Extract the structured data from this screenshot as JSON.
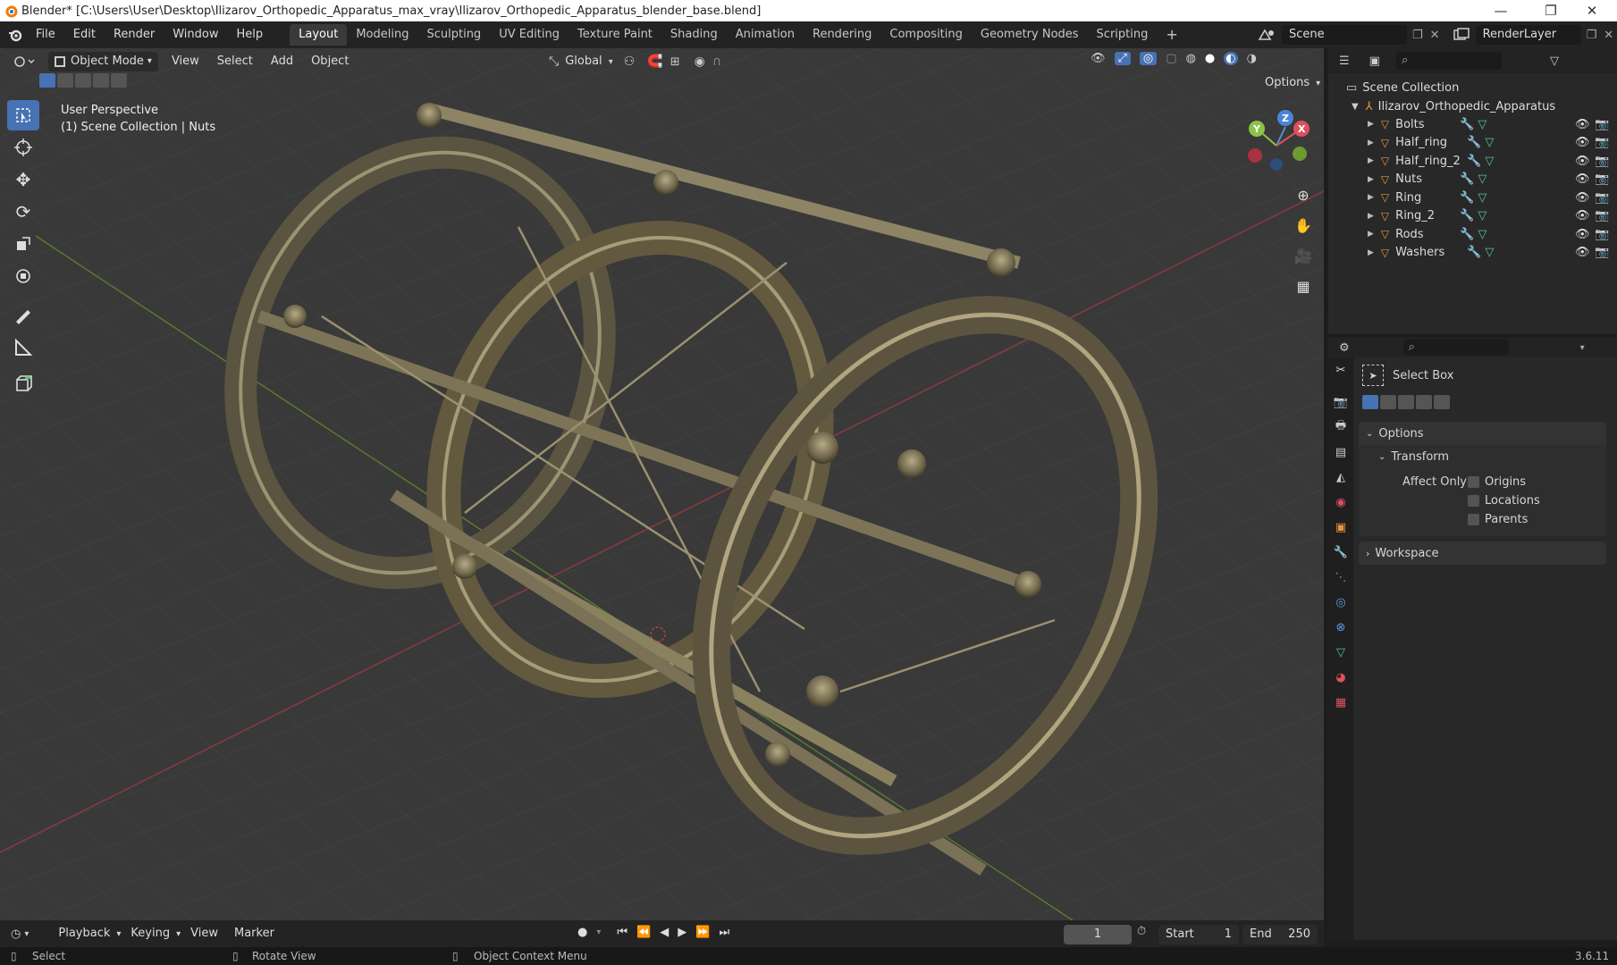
{
  "window": {
    "title": "Blender* [C:\\Users\\User\\Desktop\\Ilizarov_Orthopedic_Apparatus_max_vray\\Ilizarov_Orthopedic_Apparatus_blender_base.blend]",
    "minimize": "—",
    "restore": "❐",
    "close": "✕"
  },
  "menu": {
    "items": [
      "File",
      "Edit",
      "Render",
      "Window",
      "Help"
    ]
  },
  "workspaces": {
    "tabs": [
      "Layout",
      "Modeling",
      "Sculpting",
      "UV Editing",
      "Texture Paint",
      "Shading",
      "Animation",
      "Rendering",
      "Compositing",
      "Geometry Nodes",
      "Scripting"
    ],
    "active": "Layout",
    "add": "+"
  },
  "scene": {
    "name": "Scene",
    "render_layer": "RenderLayer"
  },
  "viewport": {
    "mode": "Object Mode",
    "menus": [
      "View",
      "Select",
      "Add",
      "Object"
    ],
    "orientation": "Global",
    "options_label": "Options",
    "perspective": "User Perspective",
    "collection_info": "(1) Scene Collection | Nuts",
    "gizmo": {
      "x": "X",
      "y": "Y",
      "z": "Z"
    }
  },
  "outliner": {
    "root": "Scene Collection",
    "collection": "Ilizarov_Orthopedic_Apparatus",
    "objects": [
      "Bolts",
      "Half_ring",
      "Half_ring_2",
      "Nuts",
      "Ring",
      "Ring_2",
      "Rods",
      "Washers"
    ]
  },
  "properties": {
    "tool_name": "Select Box",
    "options_label": "Options",
    "transform_label": "Transform",
    "affect_only": "Affect Only",
    "checkboxes": [
      "Origins",
      "Locations",
      "Parents"
    ],
    "workspace_label": "Workspace"
  },
  "timeline": {
    "menus": [
      "Playback",
      "Keying",
      "View",
      "Marker"
    ],
    "current_frame": "1",
    "start_label": "Start",
    "start": "1",
    "end_label": "End",
    "end": "250"
  },
  "status": {
    "select": "Select",
    "rotate": "Rotate View",
    "context": "Object Context Menu",
    "version": "3.6.11"
  },
  "colors": {
    "accent": "#4772b3",
    "object_orange": "#e8953c",
    "mesh_green": "#4fce88",
    "modifier_blue": "#5d9ae6",
    "axis_red": "#b5394a",
    "axis_green": "#7aa32b"
  }
}
